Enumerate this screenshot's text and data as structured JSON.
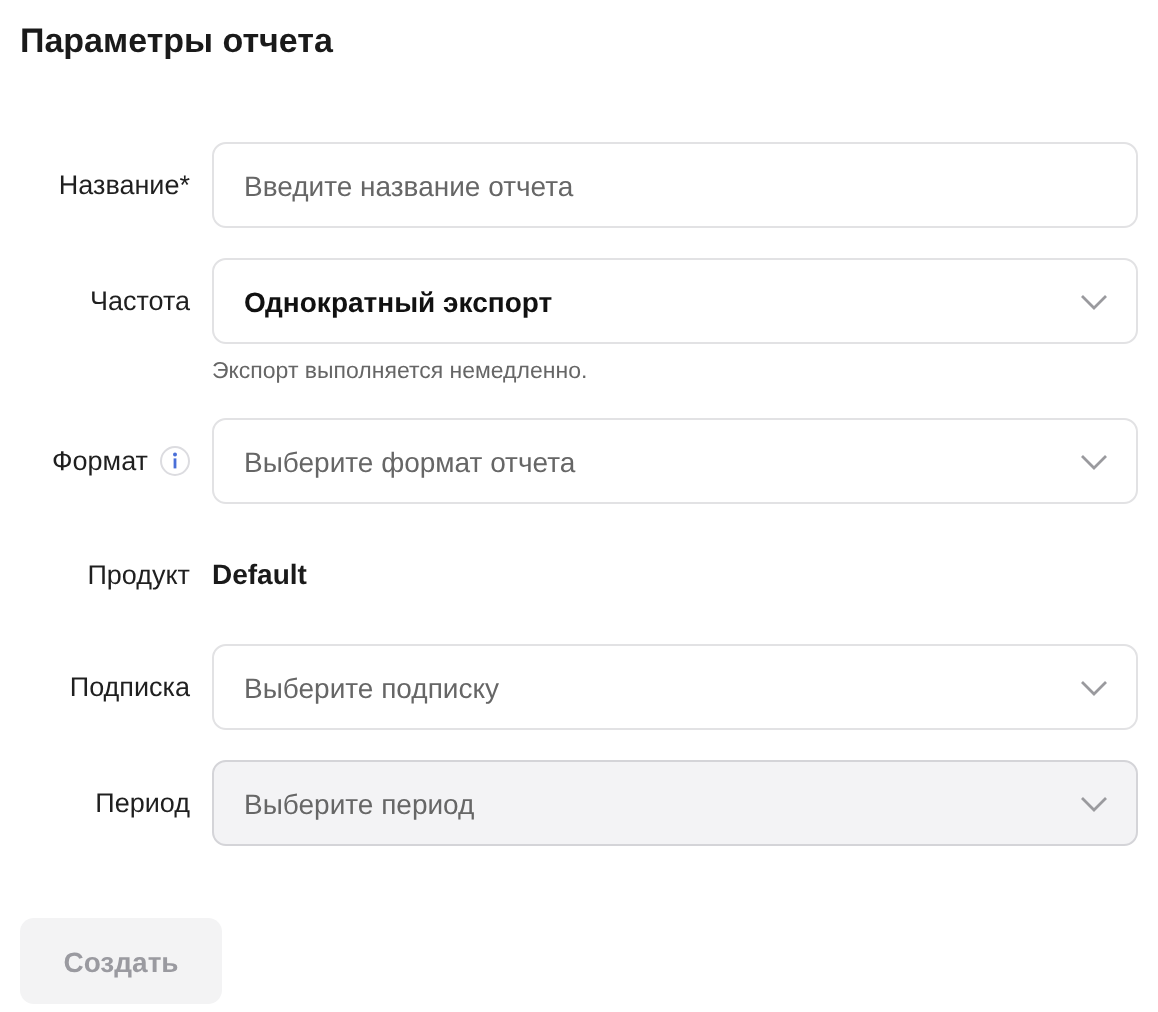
{
  "title": "Параметры отчета",
  "fields": [
    {
      "kind": "text",
      "label": "Название*",
      "placeholder": "Введите название отчета",
      "disabled": false
    },
    {
      "kind": "select",
      "label": "Частота",
      "value": "Однократный экспорт",
      "hint": "Экспорт выполняется немедленно.",
      "disabled": false
    },
    {
      "kind": "select",
      "label": "Формат",
      "info": true,
      "placeholder": "Выберите формат отчета",
      "disabled": false
    },
    {
      "kind": "static",
      "label": "Продукт",
      "value": "Default"
    },
    {
      "kind": "select",
      "label": "Подписка",
      "placeholder": "Выберите подписку",
      "disabled": false
    },
    {
      "kind": "select",
      "label": "Период",
      "placeholder": "Выберите период",
      "disabled": true
    }
  ],
  "submit": {
    "label": "Создать",
    "disabled": true
  }
}
